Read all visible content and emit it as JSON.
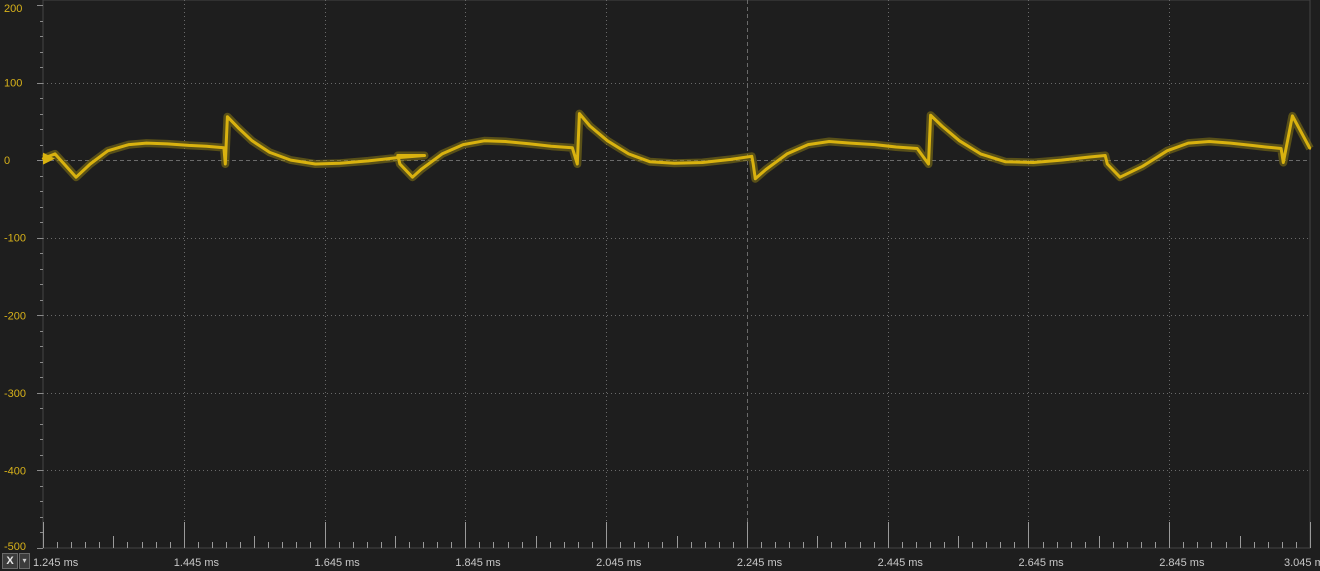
{
  "chart_data": {
    "type": "line",
    "series": [
      {
        "color": "#d9b20f",
        "x": [
          1.245,
          1.262,
          1.292,
          1.312,
          1.337,
          1.367,
          1.392,
          1.422,
          1.452,
          1.477,
          1.502,
          1.504,
          1.507,
          1.522,
          1.542,
          1.567,
          1.597,
          1.632,
          1.667,
          1.707,
          1.747,
          1.787,
          1.749,
          1.752,
          1.77,
          1.782,
          1.812,
          1.842,
          1.872,
          1.902,
          1.937,
          1.967,
          1.997,
          2.004,
          2.007,
          2.022,
          2.047,
          2.077,
          2.107,
          2.142,
          2.182,
          2.222,
          2.252,
          2.254,
          2.257,
          2.272,
          2.302,
          2.332,
          2.362,
          2.392,
          2.427,
          2.457,
          2.487,
          2.503,
          2.506,
          2.522,
          2.547,
          2.577,
          2.612,
          2.652,
          2.692,
          2.732,
          2.754,
          2.757,
          2.775,
          2.807,
          2.842,
          2.872,
          2.902,
          2.932,
          2.962,
          2.982,
          3.004,
          3.007,
          3.02,
          3.045
        ],
        "y": [
          2,
          8,
          -22,
          -5,
          12,
          20,
          22,
          21,
          19,
          18,
          16,
          -5,
          56,
          42,
          25,
          10,
          0,
          -5,
          -4,
          -1,
          3,
          6,
          6,
          -5,
          -22,
          -12,
          8,
          20,
          25,
          24,
          21,
          18,
          16,
          -5,
          60,
          44,
          25,
          8,
          -2,
          -4,
          -3,
          1,
          5,
          -5,
          -24,
          -12,
          8,
          20,
          24,
          22,
          20,
          17,
          15,
          -5,
          58,
          44,
          25,
          8,
          -2,
          -3,
          0,
          4,
          6,
          -5,
          -22,
          -8,
          12,
          22,
          24,
          22,
          19,
          17,
          15,
          -3,
          57,
          15
        ]
      }
    ],
    "yticks": [
      200,
      100,
      0,
      -100,
      -200,
      -300,
      -400,
      -500
    ],
    "ylim": [
      -500,
      200
    ],
    "xticks": [
      "1.245 ms",
      "1.445 ms",
      "1.645 ms",
      "1.845 ms",
      "2.045 ms",
      "2.245 ms",
      "2.445 ms",
      "2.645 ms",
      "2.845 ms",
      "3.045 ms"
    ],
    "xtick_values": [
      1.245,
      1.445,
      1.645,
      1.845,
      2.045,
      2.245,
      2.445,
      2.645,
      2.845,
      3.045
    ],
    "xlim": [
      1.245,
      3.045
    ],
    "grid": true,
    "zero_line": "dashed",
    "colors": {
      "background": "#1e1e1e",
      "grid": "#6a6a6a",
      "axis_text_y": "#d8b21a",
      "axis_text_x": "#c8c8c8",
      "trace": "#d9b20f",
      "trace_shadow": "#8a7a14"
    }
  },
  "controls": {
    "x_button_label": "X",
    "dropdown_icon": "chevron-down-icon"
  }
}
